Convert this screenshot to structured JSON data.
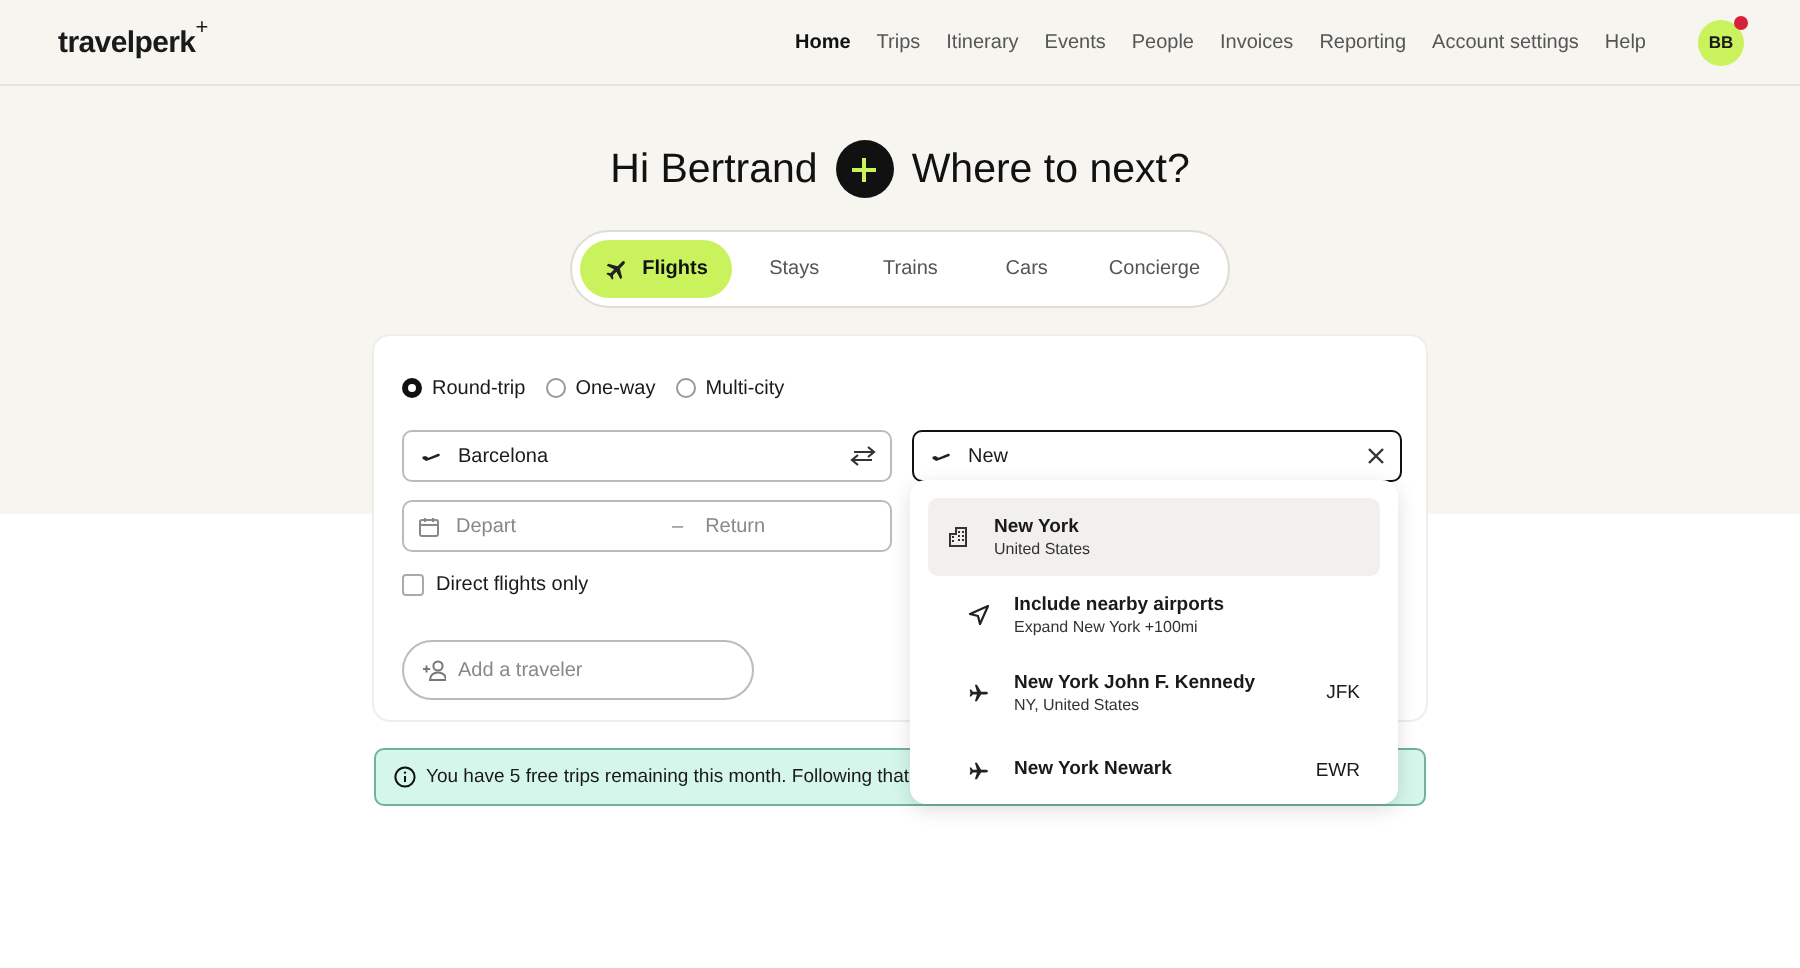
{
  "header": {
    "logo": "travelperk",
    "logo_mark": "+",
    "nav": [
      {
        "label": "Home",
        "selected": true
      },
      {
        "label": "Trips",
        "selected": false
      },
      {
        "label": "Itinerary",
        "selected": false
      },
      {
        "label": "Events",
        "selected": false
      },
      {
        "label": "People",
        "selected": false
      },
      {
        "label": "Invoices",
        "selected": false
      },
      {
        "label": "Reporting",
        "selected": false
      },
      {
        "label": "Account settings",
        "selected": false
      },
      {
        "label": "Help",
        "selected": false
      }
    ],
    "avatar": {
      "initials": "BB",
      "notification": true
    }
  },
  "greeting": {
    "hello": "Hi Bertrand",
    "question": "Where to next?"
  },
  "tabs": [
    {
      "label": "Flights",
      "selected": true
    },
    {
      "label": "Stays",
      "selected": false
    },
    {
      "label": "Trains",
      "selected": false
    },
    {
      "label": "Cars",
      "selected": false
    },
    {
      "label": "Concierge",
      "selected": false
    }
  ],
  "search": {
    "trip_types": [
      {
        "label": "Round-trip",
        "selected": true
      },
      {
        "label": "One-way",
        "selected": false
      },
      {
        "label": "Multi-city",
        "selected": false
      }
    ],
    "origin": {
      "value": "Barcelona"
    },
    "destination": {
      "value": "New"
    },
    "depart": {
      "placeholder": "Depart"
    },
    "dash": "–",
    "return": {
      "placeholder": "Return"
    },
    "direct_only": {
      "label": "Direct flights only",
      "checked": false
    },
    "traveler": {
      "placeholder": "Add a traveler"
    },
    "suggestions": [
      {
        "kind": "city",
        "title": "New York",
        "subtitle": "United States",
        "selected": true
      },
      {
        "kind": "nearby",
        "title": "Include nearby airports",
        "subtitle": "Expand New York +100mi",
        "selected": false
      },
      {
        "kind": "airport",
        "title": "New York John F. Kennedy",
        "subtitle": "NY, United States",
        "code": "JFK",
        "selected": false
      },
      {
        "kind": "airport",
        "title": "New York Newark",
        "code": "EWR",
        "selected": false
      }
    ]
  },
  "notice": {
    "text": "You have 5 free trips remaining this month. Following that"
  }
}
